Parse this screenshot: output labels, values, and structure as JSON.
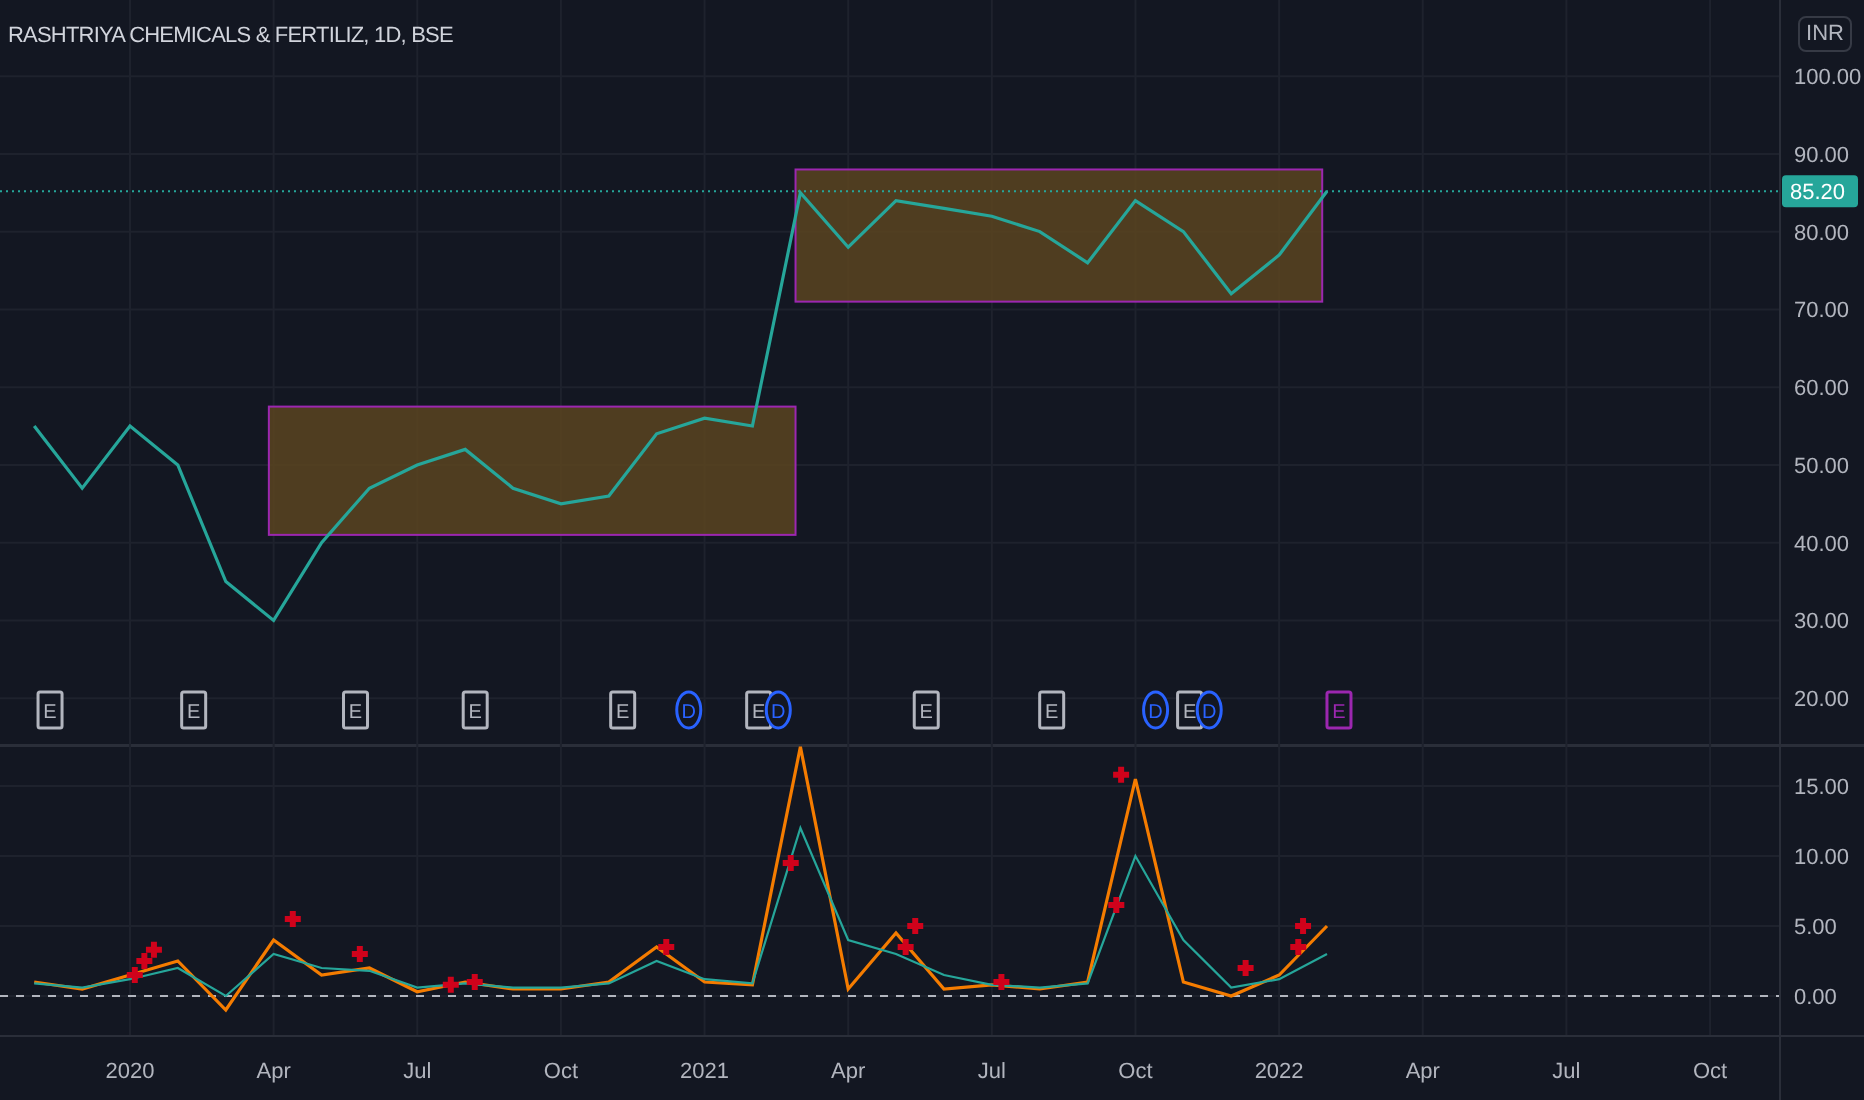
{
  "header": {
    "title": "RASHTRIYA CHEMICALS & FERTILIZ, 1D, BSE",
    "currency": "INR"
  },
  "price_pane": {
    "chart_data": {
      "type": "line",
      "grid": true,
      "ref_lines": [
        {
          "axis": "y",
          "value": 85.2,
          "label": "85.20"
        }
      ],
      "series": [
        {
          "color": "#26a69a",
          "values": [
            55,
            47,
            55,
            50,
            35,
            30,
            40,
            47,
            50,
            52,
            47,
            45,
            46,
            54,
            56,
            55,
            85,
            78,
            84,
            83,
            82,
            80,
            76,
            84,
            80,
            72,
            77,
            85.2,
            null,
            null,
            null,
            null,
            null,
            null,
            null,
            null
          ]
        }
      ],
      "ylim": [
        14.1,
        109.8
      ],
      "yticks": [
        {
          "value": 100,
          "label": "100.00"
        },
        {
          "value": 90,
          "label": "90.00"
        },
        {
          "value": 80,
          "label": "80.00"
        },
        {
          "value": 70,
          "label": "70.00"
        },
        {
          "value": 60,
          "label": "60.00"
        },
        {
          "value": 50,
          "label": "50.00"
        },
        {
          "value": 40,
          "label": "40.00"
        },
        {
          "value": 30,
          "label": "30.00"
        },
        {
          "value": 20,
          "label": "20.00"
        }
      ]
    },
    "events": [
      {
        "kind": "earnings",
        "label": "E",
        "color": "#b2b5be"
      },
      {
        "kind": "earnings",
        "label": "E",
        "color": "#b2b5be"
      },
      {
        "kind": "earnings",
        "label": "E",
        "color": "#b2b5be"
      },
      {
        "kind": "earnings",
        "label": "E",
        "color": "#b2b5be"
      },
      {
        "kind": "earnings",
        "label": "E",
        "color": "#b2b5be"
      },
      {
        "kind": "dividend",
        "label": "D",
        "color": "#2962ff"
      },
      {
        "kind": "earnings",
        "label": "E",
        "color": "#b2b5be"
      },
      {
        "kind": "dividend",
        "label": "D",
        "color": "#2962ff"
      },
      {
        "kind": "earnings",
        "label": "E",
        "color": "#b2b5be"
      },
      {
        "kind": "earnings",
        "label": "E",
        "color": "#b2b5be"
      },
      {
        "kind": "dividend",
        "label": "D",
        "color": "#2962ff"
      },
      {
        "kind": "earnings",
        "label": "E",
        "color": "#b2b5be"
      },
      {
        "kind": "dividend",
        "label": "D",
        "color": "#2962ff"
      },
      {
        "kind": "earnings",
        "label": "E",
        "color": "#9c27b0"
      }
    ]
  },
  "indicator_pane": {
    "chart_data": {
      "type": "line",
      "grid": true,
      "ref_lines": [
        {
          "axis": "y",
          "value": 0
        }
      ],
      "categories": [
        null,
        null,
        "2020",
        null,
        null,
        "Apr",
        null,
        null,
        "Jul",
        null,
        null,
        "Oct",
        null,
        null,
        "2021",
        null,
        null,
        "Apr",
        null,
        null,
        "Jul",
        null,
        null,
        "Oct",
        null,
        null,
        "2022",
        null,
        null,
        "Apr",
        null,
        null,
        "Jul",
        null,
        null,
        "Oct"
      ],
      "series": [
        {
          "color": "#f57c00",
          "values": [
            1,
            0.5,
            1.5,
            2.5,
            -1,
            4,
            1.5,
            2,
            0.3,
            1,
            0.5,
            0.5,
            1,
            3.5,
            1,
            0.8,
            17.8,
            0.5,
            4.5,
            0.5,
            0.8,
            0.5,
            1,
            15.5,
            1,
            0,
            1.5,
            5,
            null,
            null,
            null,
            null,
            null,
            null,
            null,
            null
          ]
        },
        {
          "color": "#26a69a",
          "values": [
            0.9,
            0.6,
            1.2,
            2,
            0,
            3,
            2,
            1.8,
            0.6,
            0.9,
            0.6,
            0.6,
            0.9,
            2.5,
            1.2,
            0.9,
            12,
            4,
            3,
            1.5,
            0.8,
            0.6,
            0.9,
            10,
            4,
            0.6,
            1.2,
            3,
            null,
            null,
            null,
            null,
            null,
            null,
            null,
            null
          ]
        }
      ],
      "ylim": [
        -2.86,
        18
      ],
      "yticks": [
        {
          "value": 15,
          "label": "15.00"
        },
        {
          "value": 10,
          "label": "10.00"
        },
        {
          "value": 5,
          "label": "5.00"
        },
        {
          "value": 0,
          "label": "0.00"
        }
      ]
    }
  }
}
